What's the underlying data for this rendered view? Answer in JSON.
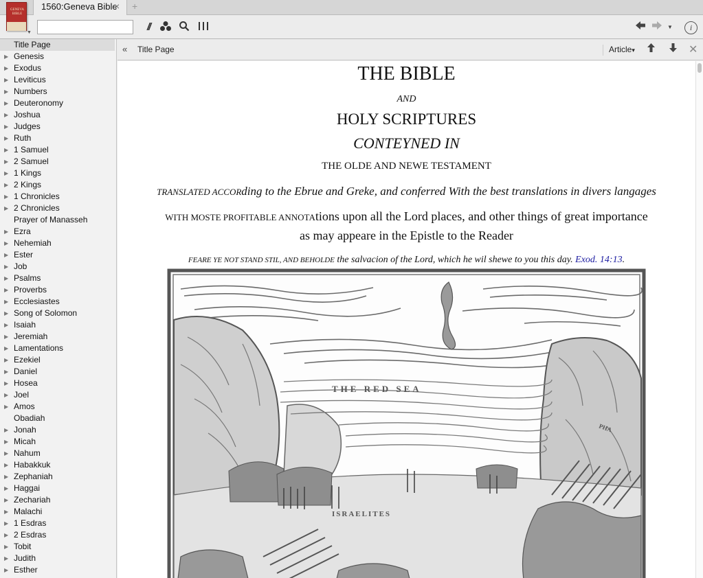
{
  "tabbar": {
    "tab_title": "1560:Geneva Bible",
    "close_glyph": "×",
    "new_tab_glyph": "+",
    "thumbnail_text": "GENEVA BIBLE"
  },
  "toolbar": {
    "search_value": "",
    "icons": [
      "parallel-icon",
      "cluster-icon",
      "search-icon",
      "columns-icon",
      "back-arrow-icon",
      "forward-arrow-icon",
      "history-menu-icon",
      "info-icon"
    ]
  },
  "sidebar": {
    "items": [
      {
        "label": "Title Page",
        "expandable": false,
        "selected": true
      },
      {
        "label": "Genesis",
        "expandable": true
      },
      {
        "label": "Exodus",
        "expandable": true
      },
      {
        "label": "Leviticus",
        "expandable": true
      },
      {
        "label": "Numbers",
        "expandable": true
      },
      {
        "label": "Deuteronomy",
        "expandable": true
      },
      {
        "label": "Joshua",
        "expandable": true
      },
      {
        "label": "Judges",
        "expandable": true
      },
      {
        "label": "Ruth",
        "expandable": true
      },
      {
        "label": "1 Samuel",
        "expandable": true
      },
      {
        "label": "2 Samuel",
        "expandable": true
      },
      {
        "label": "1 Kings",
        "expandable": true
      },
      {
        "label": "2 Kings",
        "expandable": true
      },
      {
        "label": "1 Chronicles",
        "expandable": true
      },
      {
        "label": "2 Chronicles",
        "expandable": true
      },
      {
        "label": "Prayer of Manasseh",
        "expandable": false
      },
      {
        "label": "Ezra",
        "expandable": true
      },
      {
        "label": "Nehemiah",
        "expandable": true
      },
      {
        "label": "Ester",
        "expandable": true
      },
      {
        "label": "Job",
        "expandable": true
      },
      {
        "label": "Psalms",
        "expandable": true
      },
      {
        "label": "Proverbs",
        "expandable": true
      },
      {
        "label": "Ecclesiastes",
        "expandable": true
      },
      {
        "label": "Song of Solomon",
        "expandable": true
      },
      {
        "label": "Isaiah",
        "expandable": true
      },
      {
        "label": "Jeremiah",
        "expandable": true
      },
      {
        "label": "Lamentations",
        "expandable": true
      },
      {
        "label": "Ezekiel",
        "expandable": true
      },
      {
        "label": "Daniel",
        "expandable": true
      },
      {
        "label": "Hosea",
        "expandable": true
      },
      {
        "label": "Joel",
        "expandable": true
      },
      {
        "label": "Amos",
        "expandable": true
      },
      {
        "label": "Obadiah",
        "expandable": false
      },
      {
        "label": "Jonah",
        "expandable": true
      },
      {
        "label": "Micah",
        "expandable": true
      },
      {
        "label": "Nahum",
        "expandable": true
      },
      {
        "label": "Habakkuk",
        "expandable": true
      },
      {
        "label": "Zephaniah",
        "expandable": true
      },
      {
        "label": "Haggai",
        "expandable": true
      },
      {
        "label": "Zechariah",
        "expandable": true
      },
      {
        "label": "Malachi",
        "expandable": true
      },
      {
        "label": "1 Esdras",
        "expandable": true
      },
      {
        "label": "2 Esdras",
        "expandable": true
      },
      {
        "label": "Tobit",
        "expandable": true
      },
      {
        "label": "Judith",
        "expandable": true
      },
      {
        "label": "Esther",
        "expandable": true
      }
    ]
  },
  "content_header": {
    "breadcrumb": "Title Page",
    "collapse_glyph": "«",
    "view_menu": "Article",
    "view_menu_caret": "▾"
  },
  "title_page": {
    "line1": "THE BIBLE",
    "line2": "AND",
    "line3": "HOLY SCRIPTURES",
    "line4": "CONTEYNED IN",
    "line5": "THE OLDE AND NEWE TESTAMENT",
    "line6_sc": "TRANSLATED ACCOR",
    "line6_rest": "ding to the Ebrue and Greke, and conferred With the best translations in divers langages",
    "line7_sc": "WITH MOSTE PROFITABLE ANNOTA",
    "line7_rest": "tions upon all the Lord places, and other things of great importance",
    "line8": "as may appeare in the Epistle to the Reader",
    "line9_sc": "FEARE YE NOT STAND STIL, AND BEHOLDE",
    "line9_rest": " the salvacion of the Lord, which he wil shewe to you this day. ",
    "line9_ref": "Exod. 14:13",
    "line9_end": "."
  },
  "engraving": {
    "label_sea": "THE RED SEA",
    "label_israelites": "ISRAELITES",
    "label_pharaoh": "PHA"
  }
}
